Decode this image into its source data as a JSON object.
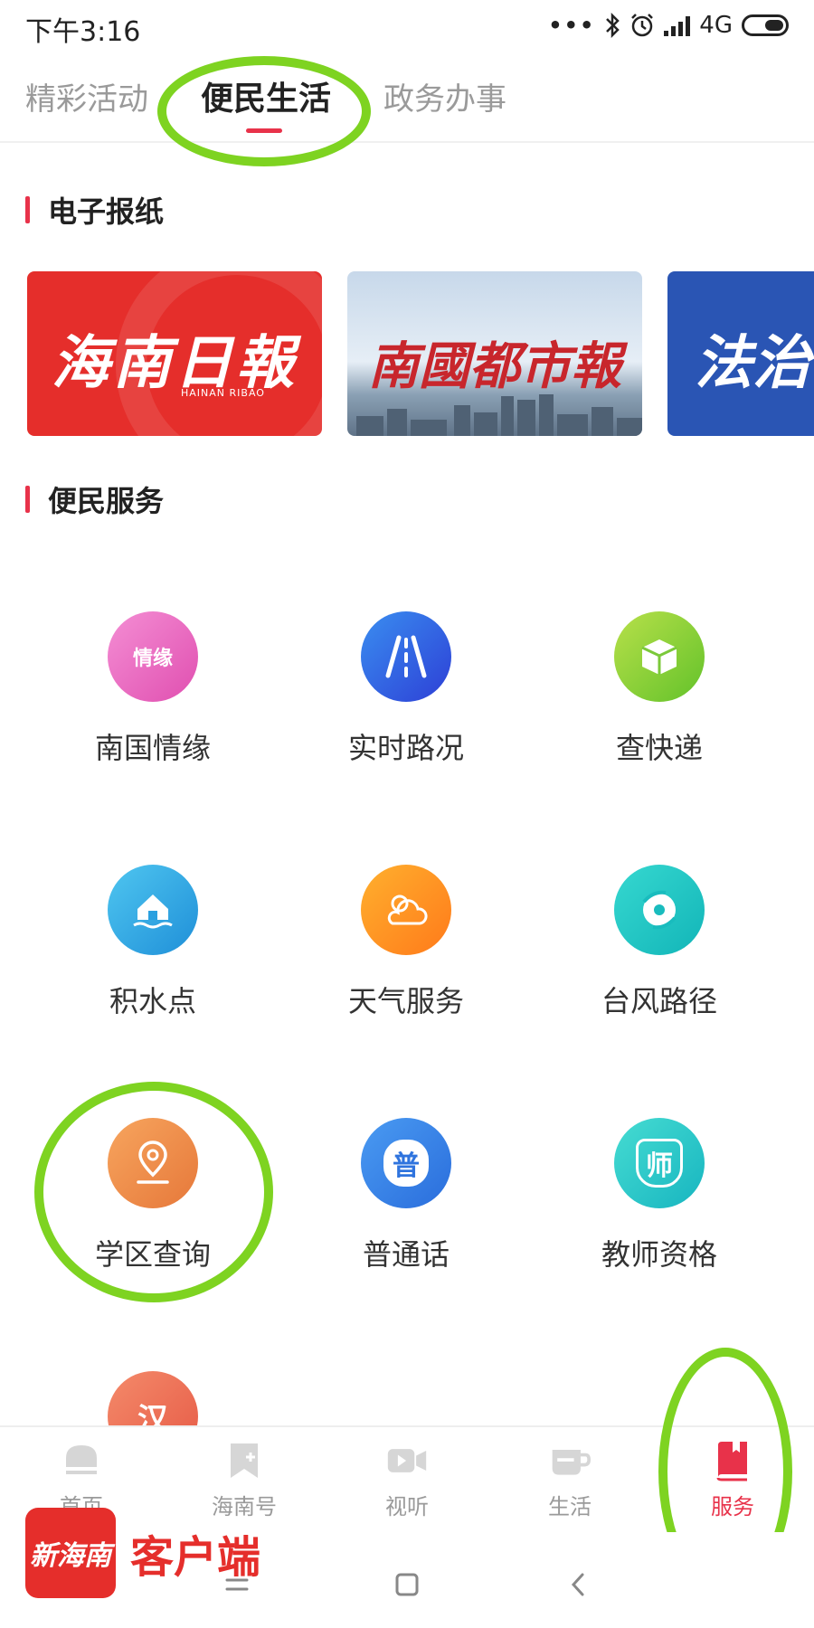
{
  "status_bar": {
    "time": "下午3:16",
    "network": "4G",
    "dots": "•••"
  },
  "top_tabs": [
    "精彩活动",
    "便民生活",
    "政务办事"
  ],
  "sections": {
    "newspapers": "电子报纸",
    "services": "便民服务"
  },
  "newspapers": [
    {
      "name": "海南日報",
      "subtitle": "HAINAN RIBAO",
      "color": "#e52e2b"
    },
    {
      "name": "南國都市報",
      "color": "#c8262c"
    },
    {
      "name": "法治",
      "color": "#2a55b4"
    }
  ],
  "services": [
    {
      "label": "南国情缘",
      "icon_char": "情缘",
      "icon": "nanguo-icon"
    },
    {
      "label": "实时路况",
      "icon_char": "",
      "icon": "road-icon"
    },
    {
      "label": "查快递",
      "icon_char": "",
      "icon": "package-icon"
    },
    {
      "label": "积水点",
      "icon_char": "",
      "icon": "house-flood-icon"
    },
    {
      "label": "天气服务",
      "icon_char": "",
      "icon": "weather-icon"
    },
    {
      "label": "台风路径",
      "icon_char": "",
      "icon": "typhoon-icon"
    },
    {
      "label": "学区查询",
      "icon_char": "",
      "icon": "location-pin-icon"
    },
    {
      "label": "普通话",
      "icon_char": "普",
      "icon": "mandarin-icon"
    },
    {
      "label": "教师资格",
      "icon_char": "师",
      "icon": "teacher-icon"
    },
    {
      "label": "",
      "icon_char": "汉",
      "icon": "hanzi-icon"
    }
  ],
  "bottom_nav": [
    "首页",
    "海南号",
    "视听",
    "生活",
    "服务"
  ],
  "watermark": {
    "logo": "新海南",
    "text": "客户端"
  },
  "colors": {
    "accent": "#e8324a",
    "highlight": "#7ed321"
  }
}
